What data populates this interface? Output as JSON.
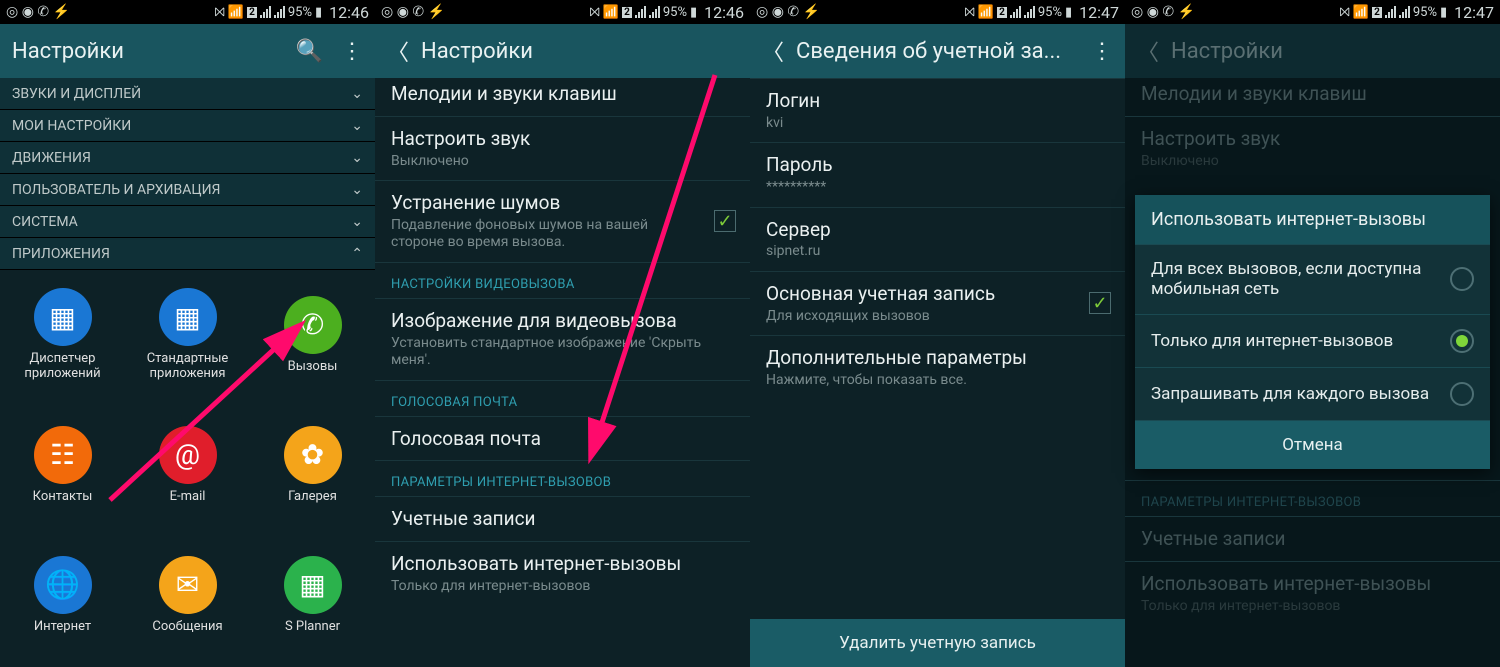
{
  "status": {
    "battery_pct": "95%",
    "time_a": "12:46",
    "time_b": "12:47"
  },
  "s1": {
    "title": "Настройки",
    "cats": [
      "ЗВУКИ И ДИСПЛЕЙ",
      "МОИ НАСТРОЙКИ",
      "ДВИЖЕНИЯ",
      "ПОЛЬЗОВАТЕЛЬ И АРХИВАЦИЯ",
      "СИСТЕМА",
      "ПРИЛОЖЕНИЯ"
    ],
    "apps": [
      {
        "label": "Диспетчер приложений",
        "color": "#1a77d4",
        "glyph": "▦"
      },
      {
        "label": "Стандартные приложения",
        "color": "#1a77d4",
        "glyph": "▦"
      },
      {
        "label": "Вызовы",
        "color": "#4caf1f",
        "glyph": "✆"
      },
      {
        "label": "Контакты",
        "color": "#f26a0a",
        "glyph": "☷"
      },
      {
        "label": "E-mail",
        "color": "#e01e2b",
        "glyph": "@"
      },
      {
        "label": "Галерея",
        "color": "#f4a41a",
        "glyph": "✿"
      },
      {
        "label": "Интернет",
        "color": "#1a77d4",
        "glyph": "🌐"
      },
      {
        "label": "Сообщения",
        "color": "#f4a41a",
        "glyph": "✉"
      },
      {
        "label": "S Planner",
        "color": "#2bb24c",
        "glyph": "▦"
      }
    ]
  },
  "s2": {
    "title": "Настройки",
    "cut_row": "Мелодии и звуки клавиш",
    "rows": [
      {
        "t": "Настроить звук",
        "s": "Выключено"
      },
      {
        "t": "Устранение шумов",
        "s": "Подавление фоновых шумов на вашей стороне во время вызова.",
        "check": true
      }
    ],
    "sect_video": "НАСТРОЙКИ ВИДЕОВЫЗОВА",
    "row_video": {
      "t": "Изображение для видеовызова",
      "s": "Установить стандартное изображение 'Скрыть меня'."
    },
    "sect_voice": "ГОЛОСОВАЯ ПОЧТА",
    "row_voice": {
      "t": "Голосовая почта"
    },
    "sect_int": "ПАРАМЕТРЫ ИНТЕРНЕТ-ВЫЗОВОВ",
    "row_acc": {
      "t": "Учетные записи"
    },
    "row_use": {
      "t": "Использовать интернет-вызовы",
      "s": "Только для интернет-вызовов"
    }
  },
  "s3": {
    "title": "Сведения об учетной за...",
    "rows": [
      {
        "t": "Логин",
        "s": "kvi"
      },
      {
        "t": "Пароль",
        "s": "**********"
      },
      {
        "t": "Сервер",
        "s": "sipnet.ru"
      },
      {
        "t": "Основная учетная запись",
        "s": "Для исходящих вызовов",
        "check": true
      },
      {
        "t": "Дополнительные параметры",
        "s": "Нажмите, чтобы показать все."
      }
    ],
    "delete": "Удалить учетную запись"
  },
  "s4": {
    "title": "Настройки",
    "cut_row": "Мелодии и звуки клавиш",
    "row_sound_t": "Настроить звук",
    "row_sound_s": "Выключено",
    "dialog_title": "Использовать интернет-вызовы",
    "opts": [
      "Для всех вызовов, если доступна мобильная сеть",
      "Только для интернет-вызовов",
      "Запрашивать для каждого вызова"
    ],
    "selected": 1,
    "cancel": "Отмена",
    "bg_sect": "ПАРАМЕТРЫ ИНТЕРНЕТ-ВЫЗОВОВ",
    "bg_acc": "Учетные записи",
    "bg_use_t": "Использовать интернет-вызовы",
    "bg_use_s": "Только для интернет-вызовов"
  }
}
